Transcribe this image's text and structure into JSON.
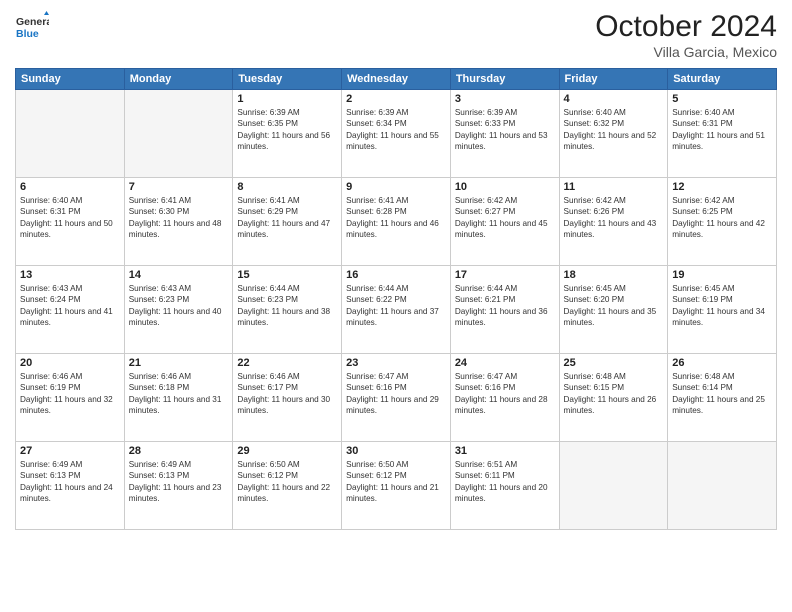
{
  "header": {
    "logo_general": "General",
    "logo_blue": "Blue",
    "month_title": "October 2024",
    "location": "Villa Garcia, Mexico"
  },
  "weekdays": [
    "Sunday",
    "Monday",
    "Tuesday",
    "Wednesday",
    "Thursday",
    "Friday",
    "Saturday"
  ],
  "weeks": [
    [
      {
        "day": "",
        "empty": true
      },
      {
        "day": "",
        "empty": true
      },
      {
        "day": "1",
        "sunrise": "6:39 AM",
        "sunset": "6:35 PM",
        "daylight": "11 hours and 56 minutes."
      },
      {
        "day": "2",
        "sunrise": "6:39 AM",
        "sunset": "6:34 PM",
        "daylight": "11 hours and 55 minutes."
      },
      {
        "day": "3",
        "sunrise": "6:39 AM",
        "sunset": "6:33 PM",
        "daylight": "11 hours and 53 minutes."
      },
      {
        "day": "4",
        "sunrise": "6:40 AM",
        "sunset": "6:32 PM",
        "daylight": "11 hours and 52 minutes."
      },
      {
        "day": "5",
        "sunrise": "6:40 AM",
        "sunset": "6:31 PM",
        "daylight": "11 hours and 51 minutes."
      }
    ],
    [
      {
        "day": "6",
        "sunrise": "6:40 AM",
        "sunset": "6:31 PM",
        "daylight": "11 hours and 50 minutes."
      },
      {
        "day": "7",
        "sunrise": "6:41 AM",
        "sunset": "6:30 PM",
        "daylight": "11 hours and 48 minutes."
      },
      {
        "day": "8",
        "sunrise": "6:41 AM",
        "sunset": "6:29 PM",
        "daylight": "11 hours and 47 minutes."
      },
      {
        "day": "9",
        "sunrise": "6:41 AM",
        "sunset": "6:28 PM",
        "daylight": "11 hours and 46 minutes."
      },
      {
        "day": "10",
        "sunrise": "6:42 AM",
        "sunset": "6:27 PM",
        "daylight": "11 hours and 45 minutes."
      },
      {
        "day": "11",
        "sunrise": "6:42 AM",
        "sunset": "6:26 PM",
        "daylight": "11 hours and 43 minutes."
      },
      {
        "day": "12",
        "sunrise": "6:42 AM",
        "sunset": "6:25 PM",
        "daylight": "11 hours and 42 minutes."
      }
    ],
    [
      {
        "day": "13",
        "sunrise": "6:43 AM",
        "sunset": "6:24 PM",
        "daylight": "11 hours and 41 minutes."
      },
      {
        "day": "14",
        "sunrise": "6:43 AM",
        "sunset": "6:23 PM",
        "daylight": "11 hours and 40 minutes."
      },
      {
        "day": "15",
        "sunrise": "6:44 AM",
        "sunset": "6:23 PM",
        "daylight": "11 hours and 38 minutes."
      },
      {
        "day": "16",
        "sunrise": "6:44 AM",
        "sunset": "6:22 PM",
        "daylight": "11 hours and 37 minutes."
      },
      {
        "day": "17",
        "sunrise": "6:44 AM",
        "sunset": "6:21 PM",
        "daylight": "11 hours and 36 minutes."
      },
      {
        "day": "18",
        "sunrise": "6:45 AM",
        "sunset": "6:20 PM",
        "daylight": "11 hours and 35 minutes."
      },
      {
        "day": "19",
        "sunrise": "6:45 AM",
        "sunset": "6:19 PM",
        "daylight": "11 hours and 34 minutes."
      }
    ],
    [
      {
        "day": "20",
        "sunrise": "6:46 AM",
        "sunset": "6:19 PM",
        "daylight": "11 hours and 32 minutes."
      },
      {
        "day": "21",
        "sunrise": "6:46 AM",
        "sunset": "6:18 PM",
        "daylight": "11 hours and 31 minutes."
      },
      {
        "day": "22",
        "sunrise": "6:46 AM",
        "sunset": "6:17 PM",
        "daylight": "11 hours and 30 minutes."
      },
      {
        "day": "23",
        "sunrise": "6:47 AM",
        "sunset": "6:16 PM",
        "daylight": "11 hours and 29 minutes."
      },
      {
        "day": "24",
        "sunrise": "6:47 AM",
        "sunset": "6:16 PM",
        "daylight": "11 hours and 28 minutes."
      },
      {
        "day": "25",
        "sunrise": "6:48 AM",
        "sunset": "6:15 PM",
        "daylight": "11 hours and 26 minutes."
      },
      {
        "day": "26",
        "sunrise": "6:48 AM",
        "sunset": "6:14 PM",
        "daylight": "11 hours and 25 minutes."
      }
    ],
    [
      {
        "day": "27",
        "sunrise": "6:49 AM",
        "sunset": "6:13 PM",
        "daylight": "11 hours and 24 minutes."
      },
      {
        "day": "28",
        "sunrise": "6:49 AM",
        "sunset": "6:13 PM",
        "daylight": "11 hours and 23 minutes."
      },
      {
        "day": "29",
        "sunrise": "6:50 AM",
        "sunset": "6:12 PM",
        "daylight": "11 hours and 22 minutes."
      },
      {
        "day": "30",
        "sunrise": "6:50 AM",
        "sunset": "6:12 PM",
        "daylight": "11 hours and 21 minutes."
      },
      {
        "day": "31",
        "sunrise": "6:51 AM",
        "sunset": "6:11 PM",
        "daylight": "11 hours and 20 minutes."
      },
      {
        "day": "",
        "empty": true
      },
      {
        "day": "",
        "empty": true
      }
    ]
  ]
}
